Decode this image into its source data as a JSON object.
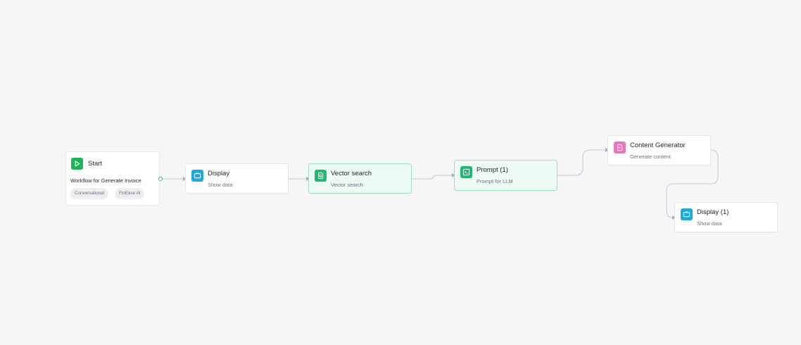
{
  "workflow": {
    "nodes": {
      "start": {
        "title": "Start",
        "description": "Workflow for Generate Invoice",
        "tags": [
          "Conversational",
          "FinEase AI"
        ],
        "icon": "play-icon",
        "icon_color": "#1db45a"
      },
      "display": {
        "title": "Display",
        "subtitle": "Show data",
        "icon": "monitor-icon",
        "icon_color": "#1ea8e0"
      },
      "vector_search": {
        "title": "Vector search",
        "subtitle": "Vector search",
        "icon": "document-search-icon",
        "icon_color": "#1fb873"
      },
      "prompt": {
        "title": "Prompt (1)",
        "subtitle": "Prompt for LLM",
        "icon": "terminal-icon",
        "icon_color": "#1fb873"
      },
      "content_generator": {
        "title": "Content Generator",
        "subtitle": "Generate content",
        "icon": "document-sparkle-icon",
        "icon_color": "#ee74b8"
      },
      "display_1": {
        "title": "Display (1)",
        "subtitle": "Show data",
        "icon": "monitor-icon",
        "icon_color": "#1ea8e0"
      }
    },
    "edge_color": "#c2c6cc"
  }
}
